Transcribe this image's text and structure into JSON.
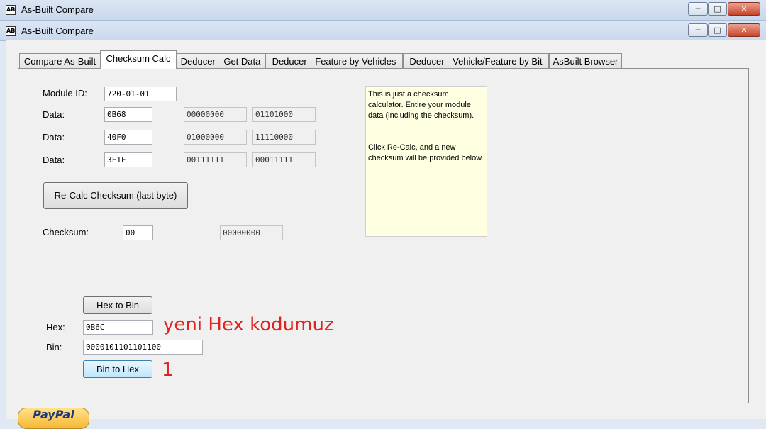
{
  "outer_window": {
    "title": "As-Built Compare",
    "controls": {
      "min": "─",
      "max": "□",
      "close": "✕"
    }
  },
  "inner_window": {
    "title": "As-Built Compare",
    "controls": {
      "min": "─",
      "max": "□",
      "close": "✕"
    }
  },
  "tabs": [
    {
      "label": "Compare As-Built",
      "active": false
    },
    {
      "label": "Checksum Calc",
      "active": true
    },
    {
      "label": "Deducer - Get Data",
      "active": false
    },
    {
      "label": "Deducer - Feature by Vehicles",
      "active": false
    },
    {
      "label": "Deducer - Vehicle/Feature by Bit",
      "active": false
    },
    {
      "label": "AsBuilt Browser",
      "active": false
    }
  ],
  "checksum_calc": {
    "module_id_label": "Module ID:",
    "module_id_value": "720-01-01",
    "data_rows": [
      {
        "label": "Data:",
        "hex": "0B68",
        "bin1": "00000000",
        "bin2": "01101000"
      },
      {
        "label": "Data:",
        "hex": "40F0",
        "bin1": "01000000",
        "bin2": "11110000"
      },
      {
        "label": "Data:",
        "hex": "3F1F",
        "bin1": "00111111",
        "bin2": "00011111"
      }
    ],
    "recalc_button": "Re-Calc Checksum (last byte)",
    "checksum_label": "Checksum:",
    "checksum_hex": "00",
    "checksum_bin": "00000000",
    "note_paragraph1": "This is just a checksum calculator.  Entire your module data (including the checksum).",
    "note_paragraph2": "Click Re-Calc, and a new checksum will be provided below.",
    "hex_to_bin_button": "Hex to Bin",
    "hex_label": "Hex:",
    "hex_value": "0B6C",
    "bin_label": "Bin:",
    "bin_value": "0000101101101100",
    "bin_to_hex_button": "Bin to Hex"
  },
  "annotations": {
    "hex_note": "yeni Hex kodumuz",
    "step": "1"
  },
  "paypal_label": "PayPal"
}
